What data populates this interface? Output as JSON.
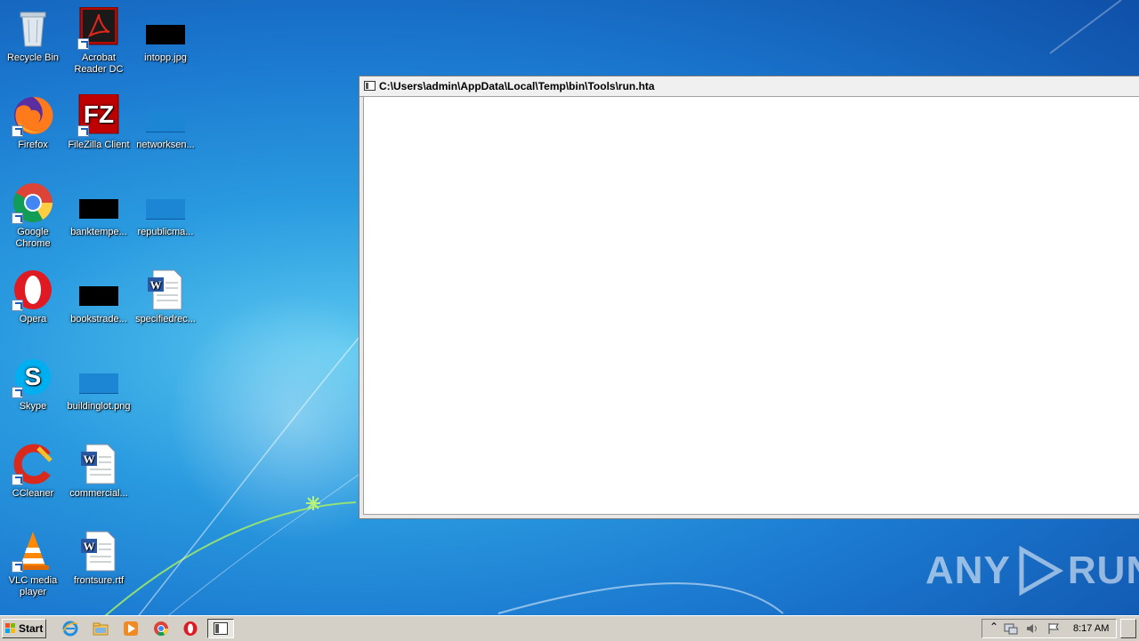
{
  "desktop": {
    "icons": [
      {
        "label": "Recycle Bin"
      },
      {
        "label": "Acrobat Reader DC"
      },
      {
        "label": "intopp.jpg"
      },
      {
        "label": "Firefox"
      },
      {
        "label": "FileZilla Client"
      },
      {
        "label": "networksen..."
      },
      {
        "label": "Google Chrome"
      },
      {
        "label": "banktempe..."
      },
      {
        "label": "republicma..."
      },
      {
        "label": "Opera"
      },
      {
        "label": "bookstrade..."
      },
      {
        "label": "specifiedrec..."
      },
      {
        "label": "Skype"
      },
      {
        "label": "buildinglot.png"
      },
      {
        "label": "CCleaner"
      },
      {
        "label": "commercial..."
      },
      {
        "label": "VLC media player"
      },
      {
        "label": "frontsure.rtf"
      }
    ]
  },
  "window": {
    "title": "C:\\Users\\admin\\AppData\\Local\\Temp\\bin\\Tools\\run.hta"
  },
  "watermark": {
    "left": "ANY",
    "right": "RUN"
  },
  "taskbar": {
    "start_label": "Start",
    "clock": "8:17 AM",
    "pinned": [
      "internet-explorer-icon",
      "windows-explorer-icon",
      "media-player-icon",
      "chrome-icon",
      "opera-icon"
    ]
  },
  "colors": {
    "taskbar": "#d4d0c8",
    "wallpaper": "#1b78cf"
  }
}
